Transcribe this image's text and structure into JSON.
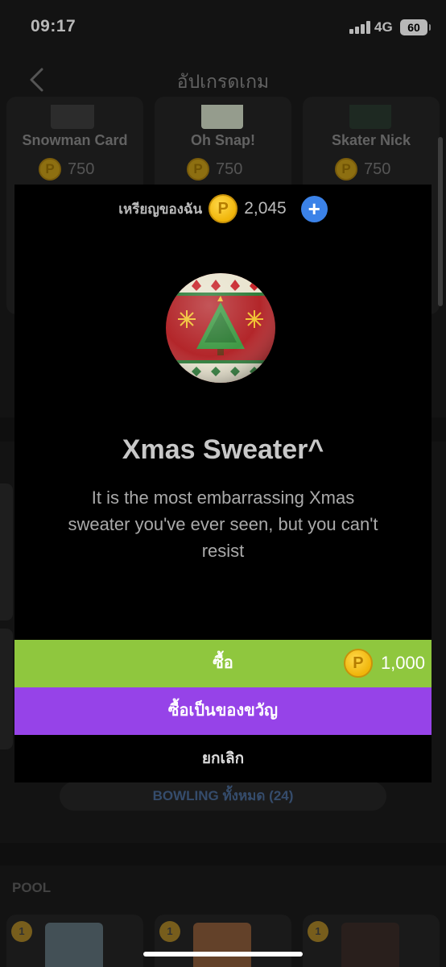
{
  "status_bar": {
    "time": "09:17",
    "network": "4G",
    "battery": "60"
  },
  "nav": {
    "title": "อัปเกรดเกม",
    "back_icon": "chevron-left-icon"
  },
  "background": {
    "games": [
      {
        "name": "Snowman Card",
        "price": "750"
      },
      {
        "name": "Oh Snap!",
        "price": "750"
      },
      {
        "name": "Skater Nick",
        "price": "750"
      }
    ],
    "view_all_label": "BOWLING ทั้งหมด (24)",
    "pool_header": "POOL",
    "pool_ranks": [
      "1",
      "1",
      "1"
    ]
  },
  "modal": {
    "wallet_label": "เหรียญของฉัน",
    "wallet_amount": "2,045",
    "coin_glyph": "P",
    "add_icon": "plus-icon",
    "item_title": "Xmas Sweater^",
    "item_description": "It is the most embarrassing Xmas sweater you've ever seen, but you can't resist",
    "buy_label": "ซื้อ",
    "buy_price": "1,000",
    "gift_label": "ซื้อเป็นของขวัญ",
    "cancel_label": "ยกเลิก"
  },
  "colors": {
    "buy_button": "#8fc73e",
    "gift_button": "#9643e8",
    "add_button": "#3b82e8",
    "coin": "#f0b50a",
    "modal_bg": "#000000"
  }
}
